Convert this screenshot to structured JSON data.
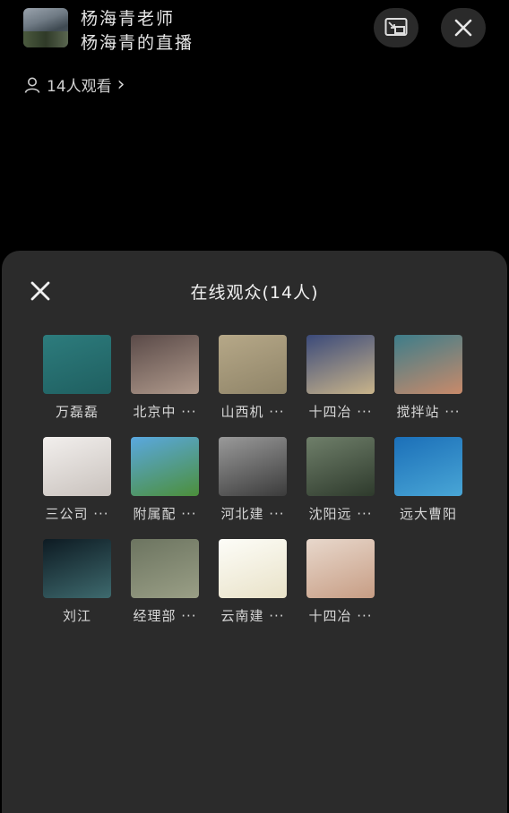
{
  "header": {
    "host_name": "杨海青老师",
    "stream_title": "杨海青的直播",
    "viewers_label": "14人观看",
    "chevron": "›"
  },
  "sheet": {
    "title": "在线观众(14人)"
  },
  "audience": [
    {
      "name": "万磊磊",
      "colors": [
        "#2d7c7d",
        "#1f5f60"
      ]
    },
    {
      "name": "北京中 ···",
      "colors": [
        "#5a4a48",
        "#b09a8c"
      ]
    },
    {
      "name": "山西机 ···",
      "colors": [
        "#b6a888",
        "#8f8468"
      ]
    },
    {
      "name": "十四冶 ···",
      "colors": [
        "#3b4a7a",
        "#c9b48a"
      ]
    },
    {
      "name": "搅拌站 ···",
      "colors": [
        "#3d7d8a",
        "#c98a6a"
      ]
    },
    {
      "name": "三公司 ···",
      "colors": [
        "#f2efed",
        "#c9c2bd"
      ]
    },
    {
      "name": "附属配 ···",
      "colors": [
        "#5aa8e0",
        "#4c8f3a"
      ]
    },
    {
      "name": "河北建 ···",
      "colors": [
        "#9a9a9a",
        "#3b3b3b"
      ]
    },
    {
      "name": "沈阳远 ···",
      "colors": [
        "#6f7f6a",
        "#2e3a2c"
      ]
    },
    {
      "name": "远大曹阳",
      "colors": [
        "#1b6fb8",
        "#49a6d6"
      ]
    },
    {
      "name": "刘江",
      "colors": [
        "#0d1a22",
        "#3e6a6e"
      ]
    },
    {
      "name": "经理部 ···",
      "colors": [
        "#6c7460",
        "#9a9f86"
      ]
    },
    {
      "name": "云南建 ···",
      "colors": [
        "#fdfdf8",
        "#e9e2c8"
      ]
    },
    {
      "name": "十四冶 ···",
      "colors": [
        "#e8d8cc",
        "#c79d84"
      ]
    }
  ]
}
